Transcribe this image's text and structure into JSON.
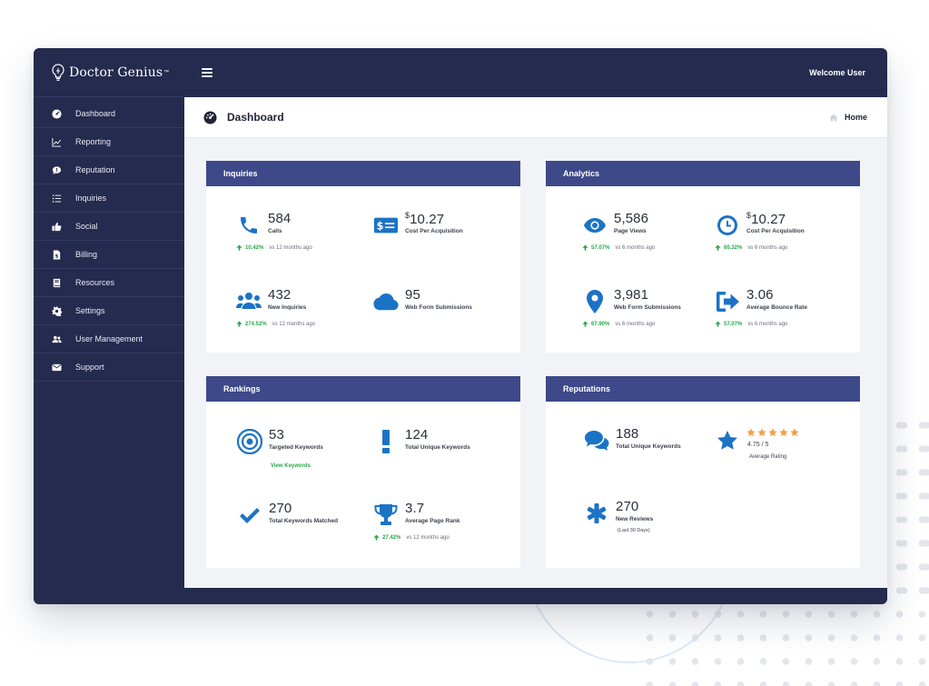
{
  "brand": {
    "name": "Doctor Genius",
    "tm": "™"
  },
  "topbar": {
    "welcome": "Welcome User"
  },
  "page": {
    "title": "Dashboard",
    "breadcrumb": "Home"
  },
  "sidebar": {
    "items": [
      {
        "label": "Dashboard",
        "icon": "dashboard-icon"
      },
      {
        "label": "Reporting",
        "icon": "chart-icon"
      },
      {
        "label": "Reputation",
        "icon": "chat-icon"
      },
      {
        "label": "Inquiries",
        "icon": "list-icon"
      },
      {
        "label": "Social",
        "icon": "thumbs-up-icon"
      },
      {
        "label": "Billing",
        "icon": "invoice-icon"
      },
      {
        "label": "Resources",
        "icon": "book-icon"
      },
      {
        "label": "Settings",
        "icon": "gear-icon"
      },
      {
        "label": "User Management",
        "icon": "users-icon"
      },
      {
        "label": "Support",
        "icon": "envelope-icon"
      }
    ]
  },
  "inquiries": {
    "title": "Inquiries",
    "calls": {
      "value": "584",
      "label": "Calls",
      "change": "10.42%",
      "compare": "vs 12 months ago"
    },
    "cpa": {
      "currency": "$",
      "value": "10.27",
      "label": "Cost Per Acquisition"
    },
    "new_inquiries": {
      "value": "432",
      "label": "New Inquiries",
      "change": "274.52%",
      "compare": "vs 12 months ago"
    },
    "web_forms": {
      "value": "95",
      "label": "Web Form Submissions"
    }
  },
  "analytics": {
    "title": "Analytics",
    "page_views": {
      "value": "5,586",
      "label": "Page Views",
      "change": "57.07%",
      "compare": "vs 6 months ago"
    },
    "cpa": {
      "currency": "$",
      "value": "10.27",
      "label": "Cost Per Acquisition",
      "change": "60.32%",
      "compare": "vs 6 months ago"
    },
    "web_forms": {
      "value": "3,981",
      "label": "Web Form Submissions",
      "change": "67.90%",
      "compare": "vs 6 months ago"
    },
    "bounce": {
      "value": "3.06",
      "label": "Average Bounce Rate",
      "change": "57.07%",
      "compare": "vs 6 months ago"
    }
  },
  "rankings": {
    "title": "Rankings",
    "targeted": {
      "value": "53",
      "label": "Targeted Keywords",
      "link": "View Keywords"
    },
    "unique": {
      "value": "124",
      "label": "Total Unique Keywords"
    },
    "matched": {
      "value": "270",
      "label": "Total Keywords Matched"
    },
    "avg_rank": {
      "value": "3.7",
      "label": "Average Page Rank",
      "change": "27.42%",
      "compare": "vs 12 months ago"
    }
  },
  "reputations": {
    "title": "Reputations",
    "unique": {
      "value": "188",
      "label": "Total Unique Keywords"
    },
    "rating": {
      "value": "4.75 / 5",
      "label": "Average Rating",
      "stars": 5
    },
    "reviews": {
      "value": "270",
      "label": "New Reviews",
      "note": "(Last 30 Days)"
    }
  },
  "colors": {
    "sidebar": "#252a4f",
    "card_header": "#3e4989",
    "icon": "#1b73c6",
    "positive": "#2aa84a",
    "star": "#f0a04b"
  }
}
